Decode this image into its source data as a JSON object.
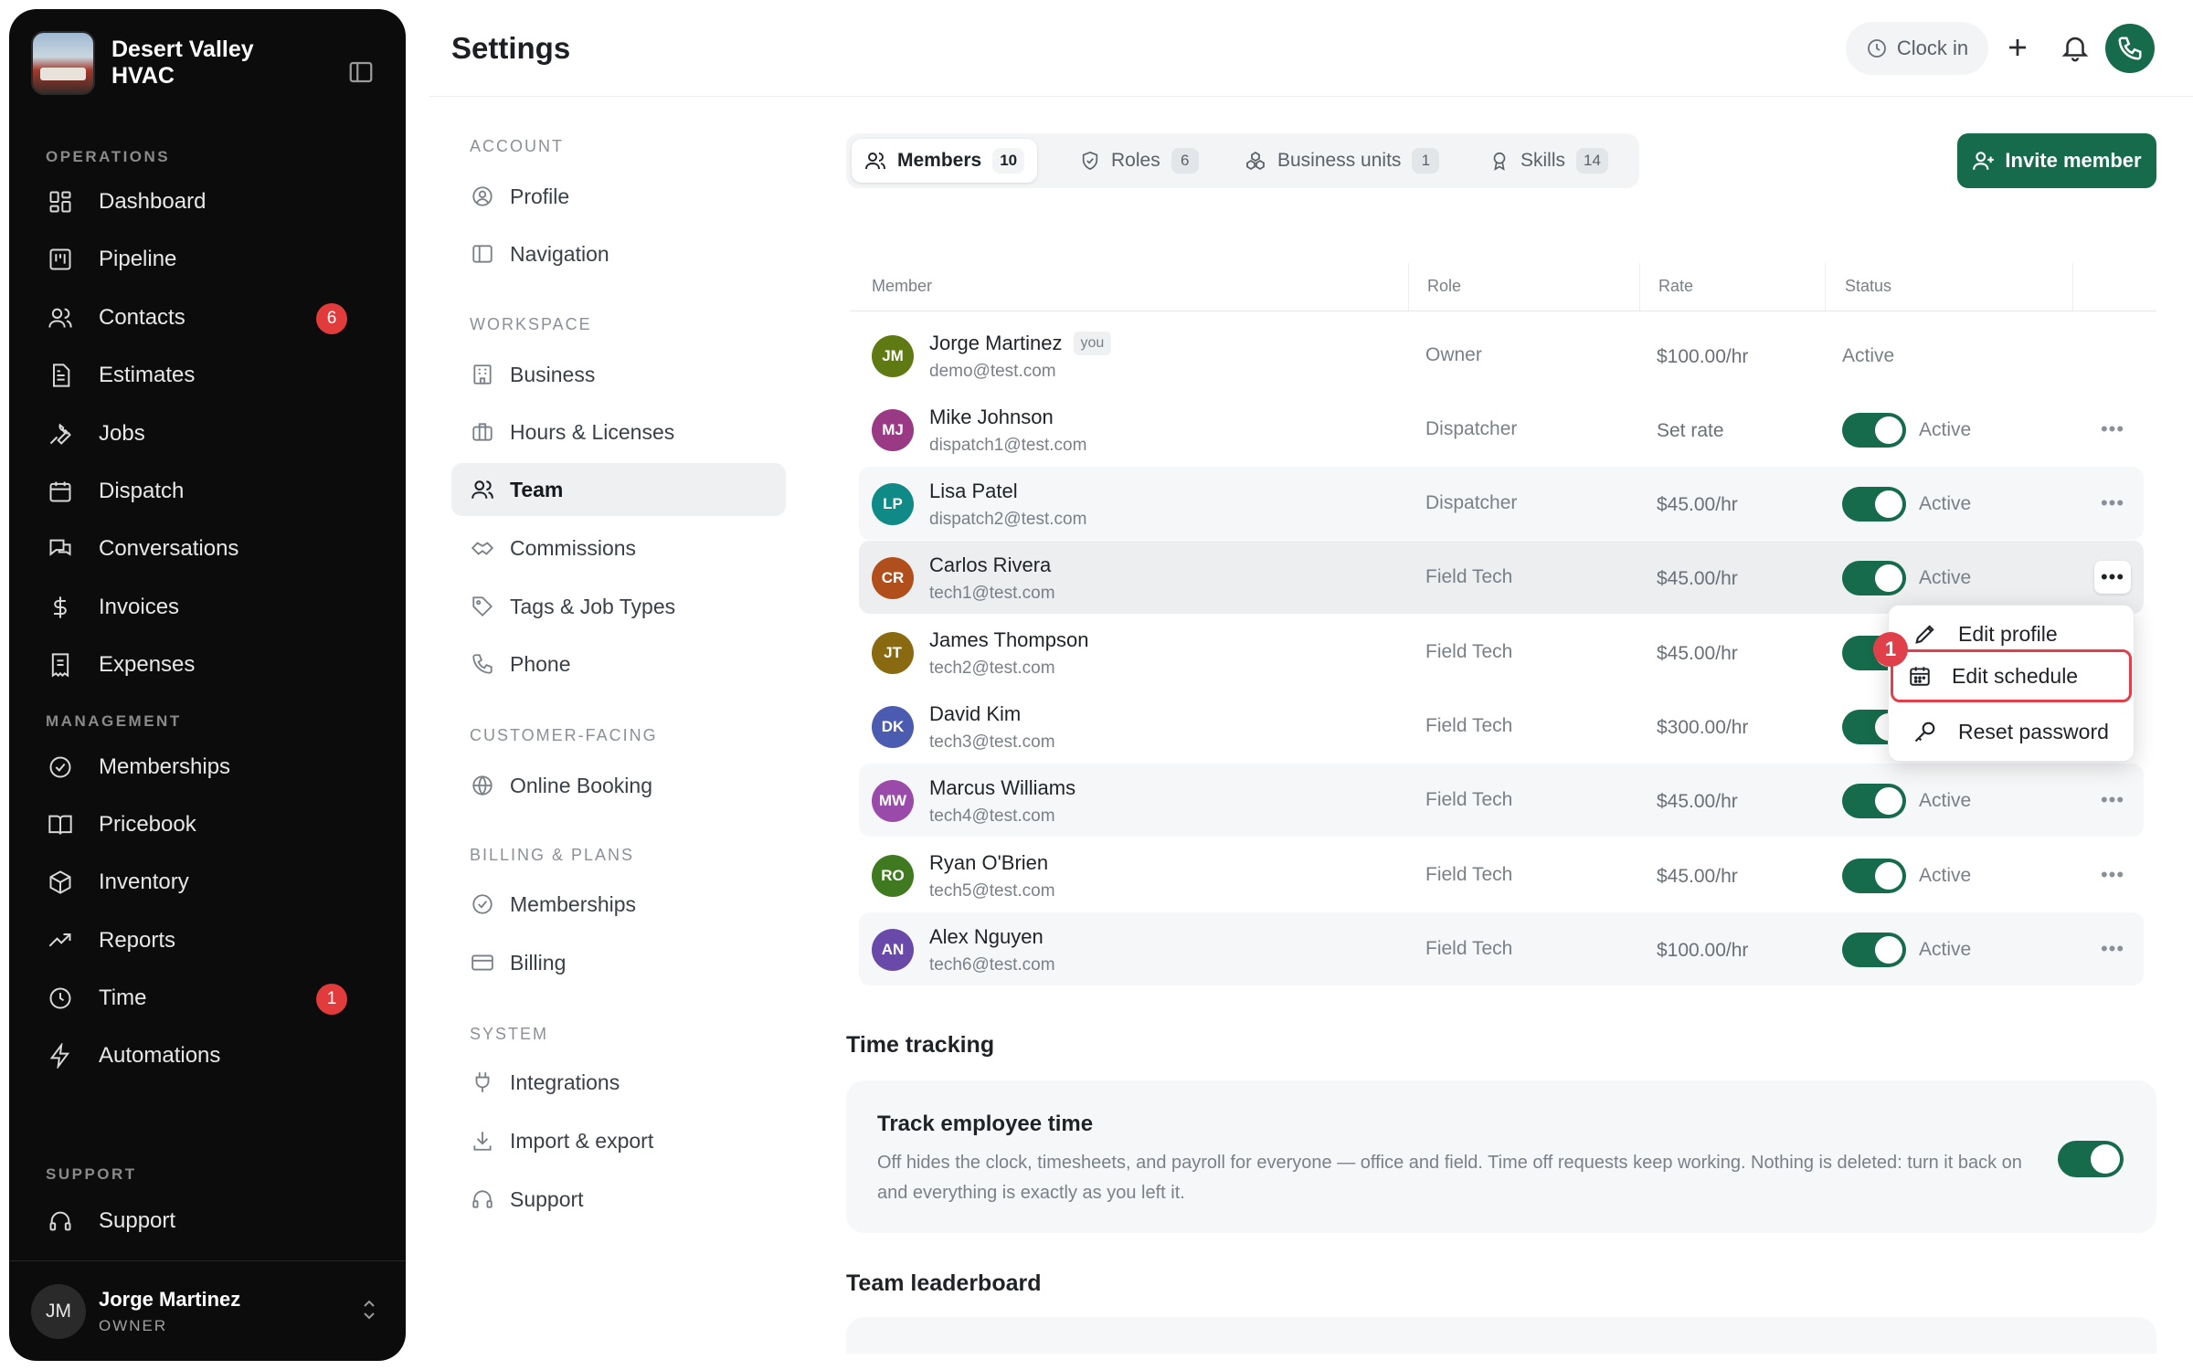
{
  "sidebar": {
    "company": "Desert Valley HVAC",
    "sections": {
      "operations": "OPERATIONS",
      "management": "MANAGEMENT",
      "support": "SUPPORT"
    },
    "items": [
      {
        "label": "Dashboard",
        "icon": "dashboard-icon"
      },
      {
        "label": "Pipeline",
        "icon": "pipeline-icon"
      },
      {
        "label": "Contacts",
        "icon": "contacts-icon",
        "badge": "6"
      },
      {
        "label": "Estimates",
        "icon": "estimates-icon"
      },
      {
        "label": "Jobs",
        "icon": "wrench-icon"
      },
      {
        "label": "Dispatch",
        "icon": "calendar-icon"
      },
      {
        "label": "Conversations",
        "icon": "chat-icon"
      },
      {
        "label": "Invoices",
        "icon": "dollar-icon"
      },
      {
        "label": "Expenses",
        "icon": "receipt-icon"
      },
      {
        "label": "Memberships",
        "icon": "check-circle-icon"
      },
      {
        "label": "Pricebook",
        "icon": "book-icon"
      },
      {
        "label": "Inventory",
        "icon": "box-icon"
      },
      {
        "label": "Reports",
        "icon": "trend-icon"
      },
      {
        "label": "Time",
        "icon": "clock-icon",
        "badge": "1"
      },
      {
        "label": "Automations",
        "icon": "bolt-icon"
      },
      {
        "label": "Support",
        "icon": "headset-icon"
      }
    ],
    "user": {
      "initials": "JM",
      "name": "Jorge Martinez",
      "role": "OWNER"
    }
  },
  "header": {
    "title": "Settings",
    "clock_in": "Clock in"
  },
  "settings_nav": {
    "sections": [
      "ACCOUNT",
      "WORKSPACE",
      "CUSTOMER-FACING",
      "BILLING & PLANS",
      "SYSTEM"
    ],
    "items": [
      {
        "label": "Profile"
      },
      {
        "label": "Navigation"
      },
      {
        "label": "Business"
      },
      {
        "label": "Hours & Licenses"
      },
      {
        "label": "Team",
        "active": true
      },
      {
        "label": "Commissions"
      },
      {
        "label": "Tags & Job Types"
      },
      {
        "label": "Phone"
      },
      {
        "label": "Online Booking"
      },
      {
        "label": "Memberships"
      },
      {
        "label": "Billing"
      },
      {
        "label": "Integrations"
      },
      {
        "label": "Import & export"
      },
      {
        "label": "Support"
      }
    ]
  },
  "tabs": [
    {
      "label": "Members",
      "count": "10",
      "active": true
    },
    {
      "label": "Roles",
      "count": "6"
    },
    {
      "label": "Business units",
      "count": "1"
    },
    {
      "label": "Skills",
      "count": "14"
    }
  ],
  "invite_label": "Invite member",
  "table": {
    "headers": [
      "Member",
      "Role",
      "Rate",
      "Status"
    ],
    "you_label": "you",
    "rows": [
      {
        "initials": "JM",
        "name": "Jorge Martinez",
        "email": "demo@test.com",
        "role": "Owner",
        "rate": "$100.00/hr",
        "status": "Active",
        "color": "#5f7a12"
      },
      {
        "initials": "MJ",
        "name": "Mike Johnson",
        "email": "dispatch1@test.com",
        "role": "Dispatcher",
        "rate": "Set rate",
        "status": "Active",
        "color": "#9b3a84"
      },
      {
        "initials": "LP",
        "name": "Lisa Patel",
        "email": "dispatch2@test.com",
        "role": "Dispatcher",
        "rate": "$45.00/hr",
        "status": "Active",
        "color": "#0f8a86"
      },
      {
        "initials": "CR",
        "name": "Carlos Rivera",
        "email": "tech1@test.com",
        "role": "Field Tech",
        "rate": "$45.00/hr",
        "status": "Active",
        "color": "#b04e1c"
      },
      {
        "initials": "JT",
        "name": "James Thompson",
        "email": "tech2@test.com",
        "role": "Field Tech",
        "rate": "$45.00/hr",
        "status": "Active",
        "color": "#8a6a10"
      },
      {
        "initials": "DK",
        "name": "David Kim",
        "email": "tech3@test.com",
        "role": "Field Tech",
        "rate": "$300.00/hr",
        "status": "Active",
        "color": "#4a5bb0"
      },
      {
        "initials": "MW",
        "name": "Marcus Williams",
        "email": "tech4@test.com",
        "role": "Field Tech",
        "rate": "$45.00/hr",
        "status": "Active",
        "color": "#9a4aa8"
      },
      {
        "initials": "RO",
        "name": "Ryan O'Brien",
        "email": "tech5@test.com",
        "role": "Field Tech",
        "rate": "$45.00/hr",
        "status": "Active",
        "color": "#3f7a20"
      },
      {
        "initials": "AN",
        "name": "Alex Nguyen",
        "email": "tech6@test.com",
        "role": "Field Tech",
        "rate": "$100.00/hr",
        "status": "Active",
        "color": "#6a4aa8"
      }
    ]
  },
  "row_menu": {
    "items": [
      "Edit profile",
      "Edit schedule",
      "Reset password"
    ],
    "step": "1"
  },
  "time_tracking": {
    "heading": "Time tracking",
    "title": "Track employee time",
    "description": "Off hides the clock, timesheets, and payroll for everyone — office and field. Time off requests keep working. Nothing is deleted: turn it back on and everything is exactly as you left it."
  },
  "leaderboard_heading": "Team leaderboard",
  "colors": {
    "accent": "#166b4c",
    "badge": "#e23b3b",
    "highlight": "#e0404a"
  }
}
